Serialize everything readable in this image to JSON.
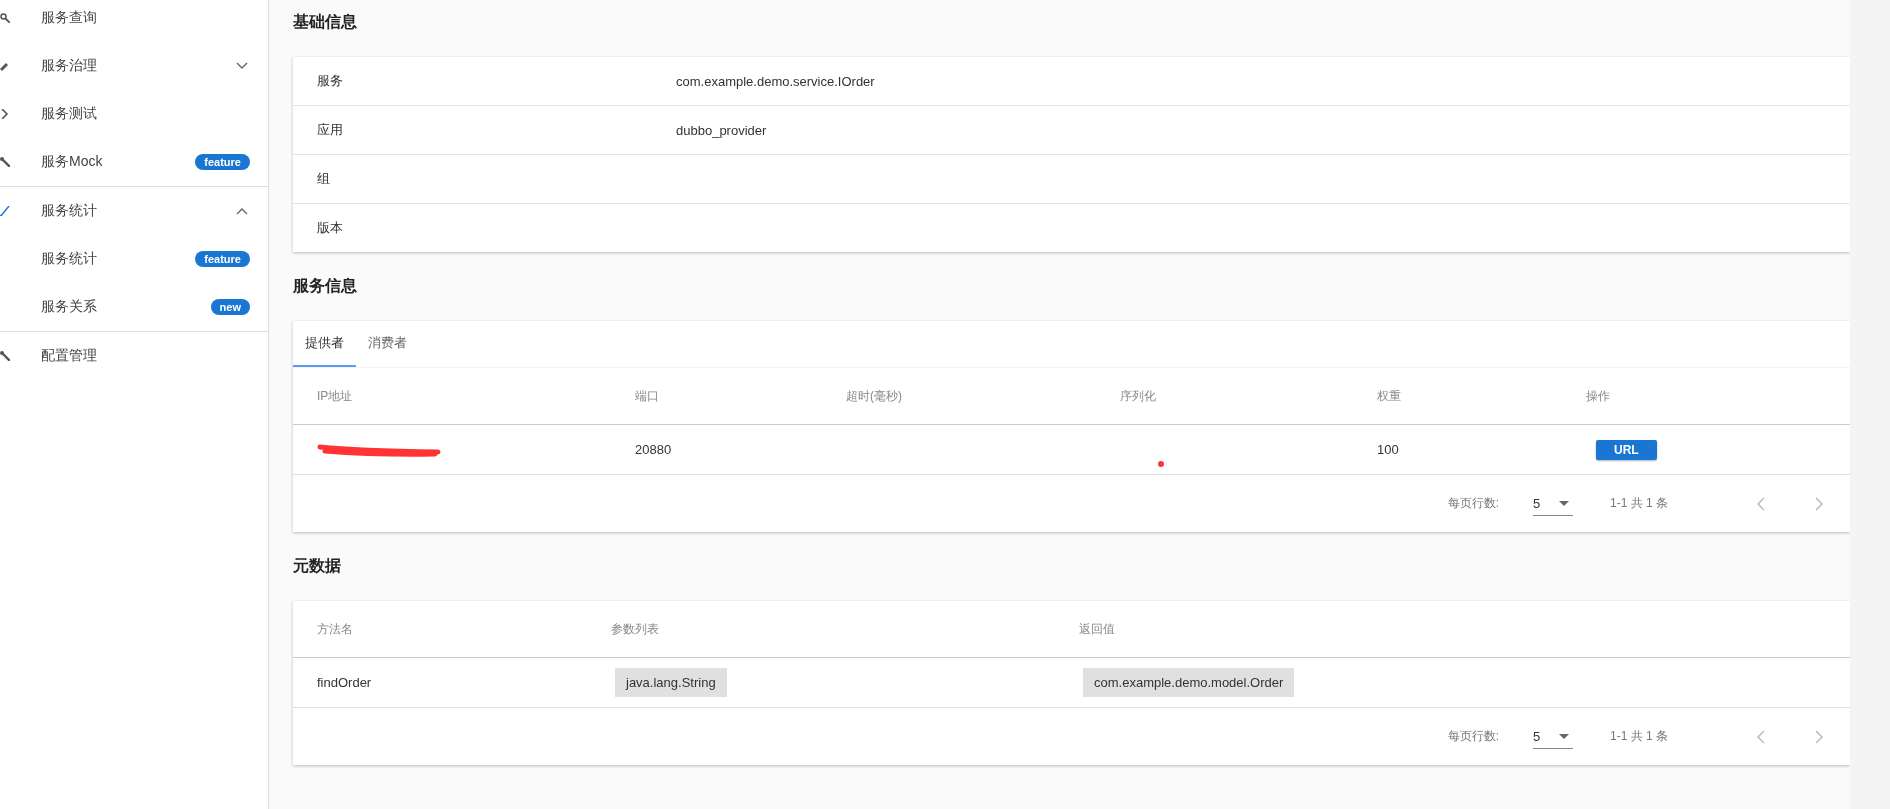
{
  "sidebar": {
    "items": [
      {
        "label": "服务查询"
      },
      {
        "label": "服务治理",
        "expanded": false
      },
      {
        "label": "服务测试"
      },
      {
        "label": "服务Mock",
        "badge": "feature"
      },
      {
        "label": "服务统计",
        "expanded": true,
        "children": [
          {
            "label": "服务统计",
            "badge": "feature"
          },
          {
            "label": "服务关系",
            "badge": "new"
          }
        ]
      },
      {
        "label": "配置管理"
      }
    ]
  },
  "basic_info": {
    "title": "基础信息",
    "rows": [
      {
        "label": "服务",
        "value": "com.example.demo.service.IOrder"
      },
      {
        "label": "应用",
        "value": "dubbo_provider"
      },
      {
        "label": "组"
      },
      {
        "label": "版本"
      }
    ]
  },
  "service_info": {
    "title": "服务信息",
    "tabs": [
      {
        "label": "提供者",
        "selected": true
      },
      {
        "label": "消费者",
        "selected": false
      }
    ],
    "columns": [
      "IP地址",
      "端口",
      "超时(毫秒)",
      "序列化",
      "权重",
      "操作"
    ],
    "rows": [
      {
        "ip_redacted": true,
        "port": "20880",
        "weight": "100",
        "action": "URL"
      }
    ],
    "pagination": {
      "rows_per_page_label": "每页行数:",
      "rows_per_page": "5",
      "range": "1-1 共 1 条"
    }
  },
  "metadata": {
    "title": "元数据",
    "columns": [
      "方法名",
      "参数列表",
      "返回值"
    ],
    "rows": [
      {
        "method": "findOrder",
        "params": [
          "java.lang.String"
        ],
        "returns": "com.example.demo.model.Order"
      }
    ],
    "pagination": {
      "rows_per_page_label": "每页行数:",
      "rows_per_page": "5",
      "range": "1-1 共 1 条"
    }
  }
}
